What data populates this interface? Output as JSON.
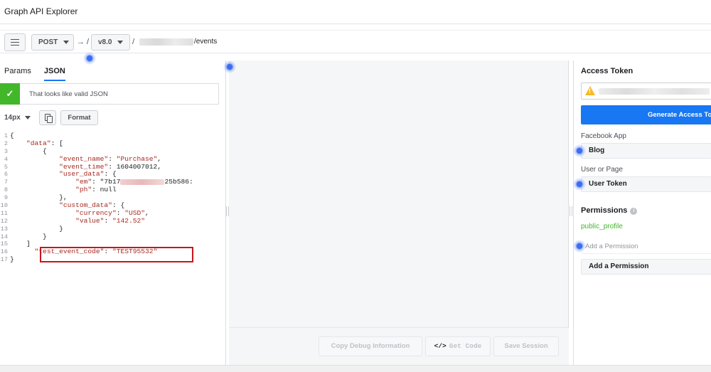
{
  "app": {
    "title": "Graph API Explorer"
  },
  "urlbar": {
    "method": "POST",
    "arrow": "→ /",
    "version": "v8.0",
    "slash": "/",
    "path_tail": "/events"
  },
  "editor": {
    "tabs": [
      "Params",
      "JSON"
    ],
    "active_tab": "JSON",
    "validation_message": "That looks like valid JSON",
    "font_size": "14px",
    "format_label": "Format",
    "highlight_color": "#c8161d",
    "lines": [
      {
        "n": "1",
        "text": "{"
      },
      {
        "n": "2",
        "text": "    \"data\": ["
      },
      {
        "n": "3",
        "text": "        {"
      },
      {
        "n": "4",
        "text": "            \"event_name\": \"Purchase\","
      },
      {
        "n": "5",
        "text": "            \"event_time\": 1604007012,"
      },
      {
        "n": "6",
        "text": "            \"user_data\": {"
      },
      {
        "n": "7",
        "pre": "                \"em\": \"7b17",
        "post": "25b586:"
      },
      {
        "n": "8",
        "text": "                \"ph\": null"
      },
      {
        "n": "9",
        "text": "            },"
      },
      {
        "n": "10",
        "text": "            \"custom_data\": {"
      },
      {
        "n": "11",
        "text": "                \"currency\": \"USD\","
      },
      {
        "n": "12",
        "text": "                \"value\": \"142.52\""
      },
      {
        "n": "13",
        "text": "            }"
      },
      {
        "n": "14",
        "text": "        }"
      },
      {
        "n": "15",
        "text": "    ]"
      },
      {
        "n": "16",
        "text": "      \"test_event_code\": \"TEST95532\""
      },
      {
        "n": "17",
        "text": "}"
      }
    ]
  },
  "response": {
    "copy_debug": "Copy Debug Information",
    "get_code_icon": "</>",
    "get_code": "Get Code",
    "save_session": "Save Session"
  },
  "token_panel": {
    "title": "Access Token",
    "warning_icon": "warning-icon",
    "generate_label": "Generate Access To",
    "facebook_app_label": "Facebook App",
    "facebook_app_value": "Blog",
    "user_or_page_label": "User or Page",
    "user_or_page_value": "User Token",
    "permissions_title": "Permissions",
    "permissions": [
      "public_profile"
    ],
    "add_permission_placeholder": "Add a Permission",
    "add_permission_button": "Add a Permission",
    "accent_color": "#1877f2",
    "permission_color": "#42b72a"
  }
}
